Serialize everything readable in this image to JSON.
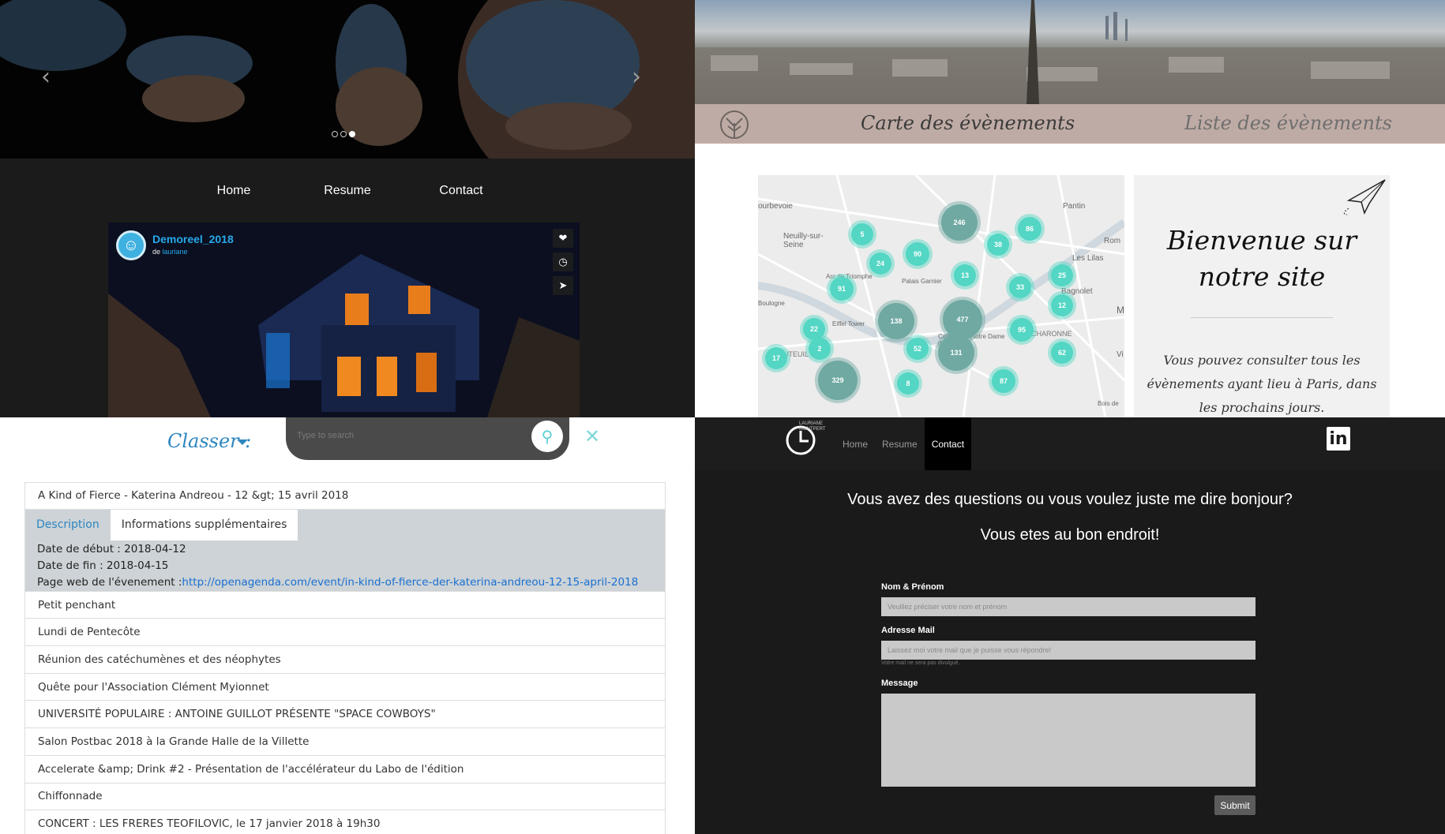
{
  "q1": {
    "carousel_prev": "‹",
    "carousel_next": "›",
    "nav": [
      "Home",
      "Resume",
      "Contact"
    ],
    "video": {
      "title": "Demoreel_2018",
      "by": "de",
      "author": "lauriane"
    }
  },
  "q2": {
    "tab_map": "Carte des évènements",
    "tab_list": "Liste des évènements",
    "map_labels": [
      "ourbevoie",
      "Neuilly-sur-Seine",
      "Pantin",
      "Les Lilas",
      "Bagnolet",
      "Arc de Triomphe",
      "Palais Garnier",
      "Boulogne",
      "Eiffel Tower",
      "Cathedrale Notre Dame de Paris",
      "CHARONNE",
      "AUTEUIL",
      "Bois de",
      "Vi",
      "M",
      "Rom"
    ],
    "clusters": [
      5,
      246,
      86,
      38,
      90,
      24,
      13,
      25,
      91,
      33,
      12,
      138,
      477,
      22,
      95,
      2,
      52,
      131,
      62,
      17,
      329,
      8,
      87
    ],
    "welcome_title": "Bienvenue sur notre site",
    "welcome_text": "Vous pouvez consulter tous les évènements ayant lieu à Paris, dans les prochains jours."
  },
  "q3": {
    "classer": "Classer :",
    "search_placeholder": "Type to search",
    "close": "✕",
    "first_event": "A Kind of Fierce - Katerina Andreou - 12 &gt; 15 avril 2018",
    "tab_desc": "Description",
    "tab_info": "Informations supplémentaires",
    "start": "Date de début : 2018-04-12",
    "end": "Date de fin : 2018-04-15",
    "web_label": "Page web de l'évenement :",
    "web_url": "http://openagenda.com/event/in-kind-of-fierce-der-katerina-andreou-12-15-april-2018",
    "events": [
      "Petit penchant",
      "Lundi de Pentecôte",
      "Réunion des catéchumènes et des néophytes",
      "Quête pour l'Association Clément Myionnet",
      "UNIVERSITÉ POPULAIRE : ANTOINE GUILLOT PRÉSENTE \"SPACE COWBOYS\"",
      "Salon Postbac 2018 à la Grande Halle de la Villette",
      "Accelerate &amp; Drink #2 - Présentation de l'accélérateur du Labo de l'édition",
      "Chiffonnade",
      "CONCERT : LES FRERES TEOFILOVIC, le 17 janvier 2018 à 19h30"
    ]
  },
  "q4": {
    "logo_text": "LAURIANE MONTPERT",
    "nav": [
      "Home",
      "Resume",
      "Contact"
    ],
    "linkedin": "in",
    "heading1": "Vous avez des questions ou vous voulez juste me dire bonjour?",
    "heading2": "Vous etes au bon endroit!",
    "name_label": "Nom & Prénom",
    "name_ph": "Veuillez préciser votre nom et prénom",
    "mail_label": "Adresse Mail",
    "mail_ph": "Laissez moi votre mail que je puisse vous répondre!",
    "mail_help": "Votre mail ne sera pas divulgué.",
    "msg_label": "Message",
    "submit": "Submit"
  }
}
